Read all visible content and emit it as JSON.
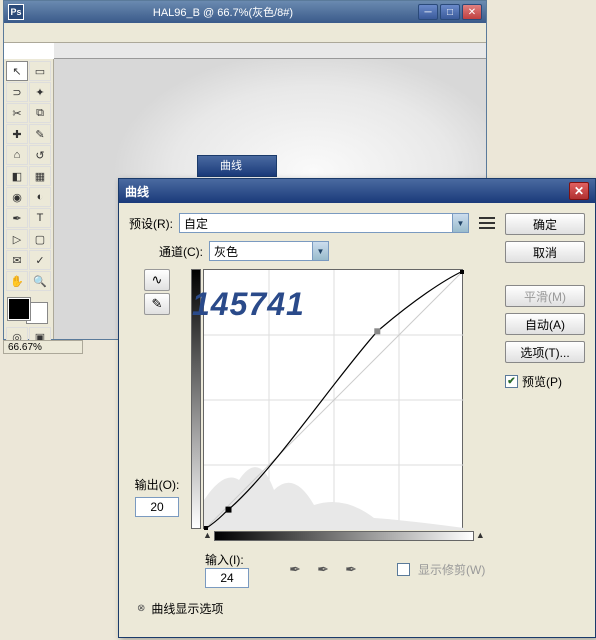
{
  "ps": {
    "title": "HAL96_B @ 66.7%(灰色/8#)",
    "zoom": "66.67%"
  },
  "stub_title": "曲线",
  "curves": {
    "title": "曲线",
    "preset_label": "预设(R):",
    "preset_value": "自定",
    "channel_label": "通道(C):",
    "channel_value": "灰色",
    "output_label": "输出(O):",
    "output_value": "20",
    "input_label": "输入(I):",
    "input_value": "24",
    "show_clip": "显示修剪(W)",
    "disclosure": "曲线显示选项",
    "buttons": {
      "ok": "确定",
      "cancel": "取消",
      "smooth": "平滑(M)",
      "auto": "自动(A)",
      "options": "选项(T)...",
      "preview": "预览(P)"
    }
  },
  "watermark": "145741",
  "chart_data": {
    "type": "line",
    "title": "曲线",
    "xlabel": "输入",
    "ylabel": "输出",
    "xlim": [
      0,
      255
    ],
    "ylim": [
      0,
      255
    ],
    "series": [
      {
        "name": "baseline",
        "x": [
          0,
          255
        ],
        "y": [
          0,
          255
        ]
      },
      {
        "name": "curve",
        "x": [
          0,
          24,
          170,
          255
        ],
        "y": [
          0,
          20,
          195,
          255
        ]
      }
    ],
    "points": [
      {
        "x": 0,
        "y": 0
      },
      {
        "x": 24,
        "y": 20,
        "selected": false
      },
      {
        "x": 170,
        "y": 195,
        "selected": true
      },
      {
        "x": 255,
        "y": 255
      }
    ]
  }
}
